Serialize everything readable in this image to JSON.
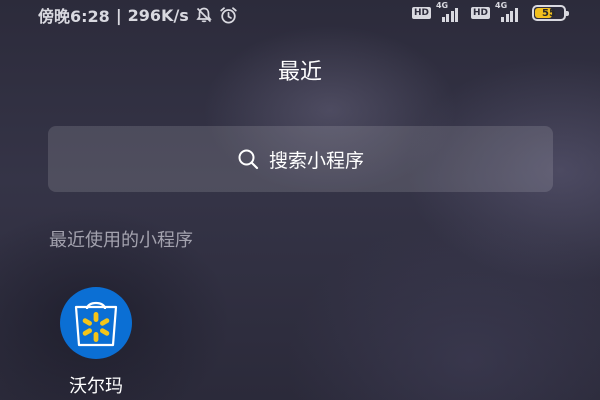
{
  "status_bar": {
    "time": "傍晚6:28",
    "speed": "296K/s",
    "separator": "|",
    "hd_label_1": "HD",
    "hd_label_2": "HD",
    "network_1": "4G",
    "network_2": "4G",
    "battery_level": "55",
    "icons": [
      "alarm-off-icon",
      "alarm-clock-icon",
      "signal-icon",
      "battery-icon"
    ]
  },
  "page": {
    "title": "最近"
  },
  "search": {
    "placeholder": "搜索小程序",
    "icon": "search-icon"
  },
  "recent_section": {
    "label": "最近使用的小程序",
    "apps": [
      {
        "name": "沃尔玛",
        "icon": "walmart-icon",
        "icon_bg": "#0b6fd4",
        "icon_accent": "#f5c518"
      }
    ]
  },
  "colors": {
    "background": "#2e2d3d",
    "text_primary": "#ffffff",
    "text_secondary": "#a3a2ae",
    "battery": "#f2c01e"
  }
}
